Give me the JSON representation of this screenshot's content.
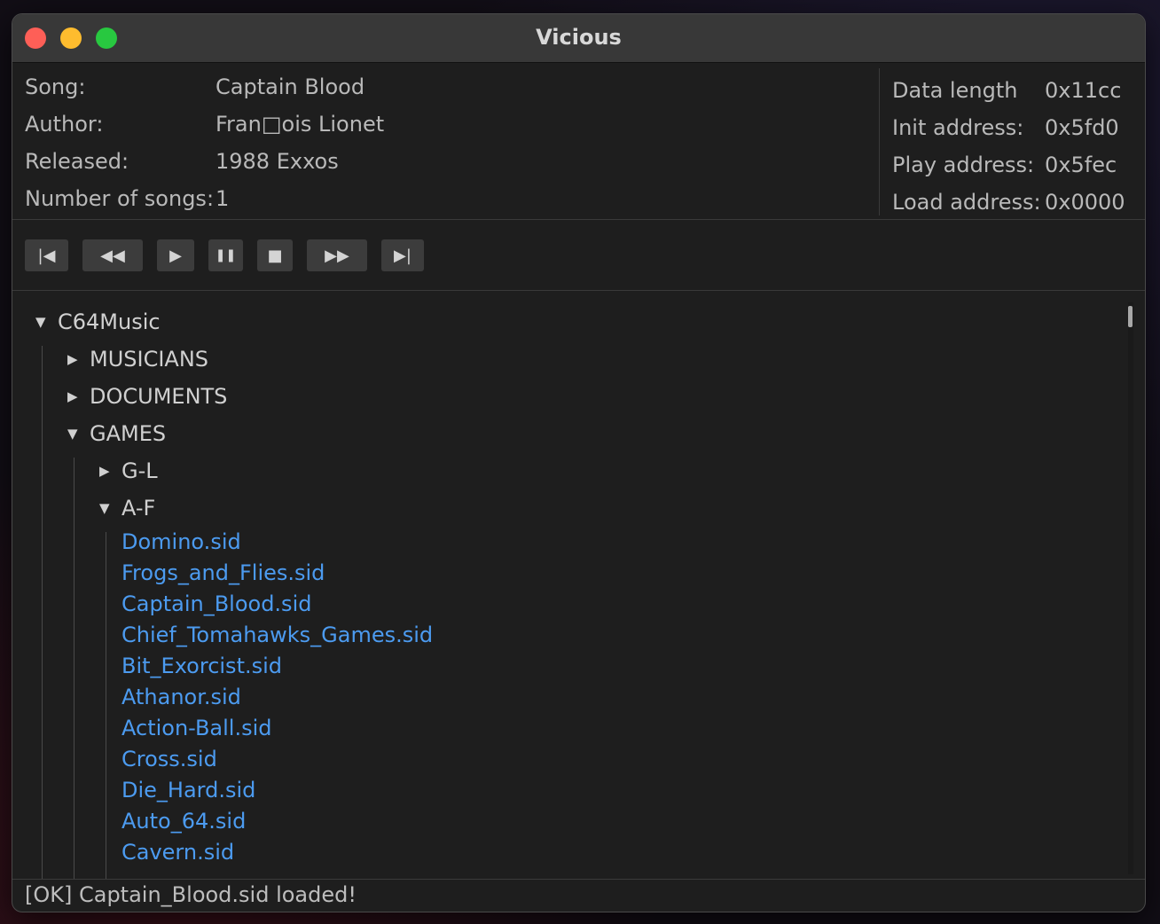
{
  "window": {
    "title": "Vicious"
  },
  "info": {
    "left": [
      {
        "label": "Song:",
        "value": "Captain Blood"
      },
      {
        "label": "Author:",
        "value": "Fran□ois Lionet"
      },
      {
        "label": "Released:",
        "value": "1988 Exxos"
      },
      {
        "label": "Number of songs:",
        "value": "1"
      }
    ],
    "right": [
      {
        "label": "Data length",
        "value": "0x11cc"
      },
      {
        "label": "Init address:",
        "value": "0x5fd0"
      },
      {
        "label": "Play address:",
        "value": "0x5fec"
      },
      {
        "label": "Load address:",
        "value": "0x0000"
      }
    ]
  },
  "controls": {
    "first": "|◀",
    "rewind": "◀◀",
    "play": "▶",
    "pause": "❚❚",
    "stop": "■",
    "forward": "▶▶",
    "last": "▶|"
  },
  "tree": {
    "root": {
      "label": "C64Music",
      "icon": "triangle-down-icon"
    },
    "musicians": {
      "label": "MUSICIANS",
      "icon": "triangle-right-icon"
    },
    "documents": {
      "label": "DOCUMENTS",
      "icon": "triangle-right-icon"
    },
    "games": {
      "label": "GAMES",
      "icon": "triangle-down-icon"
    },
    "g_l": {
      "label": "G-L",
      "icon": "triangle-right-icon"
    },
    "a_f": {
      "label": "A-F",
      "icon": "triangle-down-icon"
    },
    "arrows": {
      "down": "▼",
      "right": "▶"
    },
    "files": [
      "Domino.sid",
      "Frogs_and_Flies.sid",
      "Captain_Blood.sid",
      "Chief_Tomahawks_Games.sid",
      "Bit_Exorcist.sid",
      "Athanor.sid",
      "Action-Ball.sid",
      "Cross.sid",
      "Die_Hard.sid",
      "Auto_64.sid",
      "Cavern.sid"
    ]
  },
  "status": {
    "message": "[OK] Captain_Blood.sid loaded!"
  },
  "colors": {
    "file_link": "#4c9bf0",
    "close": "#fe5f57",
    "minimize": "#febc2e",
    "maximize": "#28c840"
  }
}
